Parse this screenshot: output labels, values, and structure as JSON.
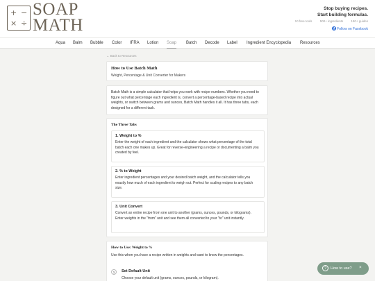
{
  "brand": {
    "name_line1": "SOAP",
    "name_line2": "MATH",
    "logo_symbols": [
      "+",
      "−",
      "×",
      "÷"
    ]
  },
  "header": {
    "tagline_line1": "Stop buying recipes.",
    "tagline_line2": "Start building formulas.",
    "stats": [
      "10 free tools",
      "500+ ingredients",
      "150+ guides"
    ],
    "follow_label": "Follow on Facebook"
  },
  "nav": {
    "items": [
      "Aqua",
      "Balm",
      "Bubble",
      "Color",
      "IFRA",
      "Lotion",
      "Soap",
      "Batch",
      "Decode",
      "Label",
      "Ingredient Encyclopedia",
      "Resources"
    ],
    "active": "Soap"
  },
  "back_link": "← Back to Resources",
  "page": {
    "title": "How to Use Batch Math",
    "subtitle": "Weight, Percentage & Unit Converter for Makers"
  },
  "intro": "Batch Math is a simple calculator that helps you work with recipe numbers. Whether you need to figure out what percentage each ingredient is, convert a percentage-based recipe into actual weights, or switch between grams and ounces, Batch Math handles it all. It has three tabs, each designed for a different task.",
  "three_tabs": {
    "heading": "The Three Tabs",
    "tabs": [
      {
        "title": "1. Weight to %",
        "body": "Enter the weight of each ingredient and the calculator shows what percentage of the total batch each one makes up. Great for reverse-engineering a recipe or documenting a balm you created by feel."
      },
      {
        "title": "2. % to Weight",
        "body": "Enter ingredient percentages and your desired batch weight, and the calculator tells you exactly how much of each ingredient to weigh out. Perfect for scaling recipes to any batch size."
      },
      {
        "title": "3. Unit Convert",
        "body": "Convert an entire recipe from one unit to another (grams, ounces, pounds, or kilograms). Enter weights in the \"from\" unit and see them all converted to your \"to\" unit instantly."
      }
    ]
  },
  "howto": {
    "heading": "How to Use: Weight to %",
    "text": "Use this when you have a recipe written in weights and want to know the percentages.",
    "step": {
      "number": "1",
      "title": "Set Default Unit",
      "desc": "Choose your default unit (grams, ounces, pounds, or kilogram)."
    }
  },
  "help": {
    "label": "How to use?",
    "q": "?",
    "close": "×"
  }
}
